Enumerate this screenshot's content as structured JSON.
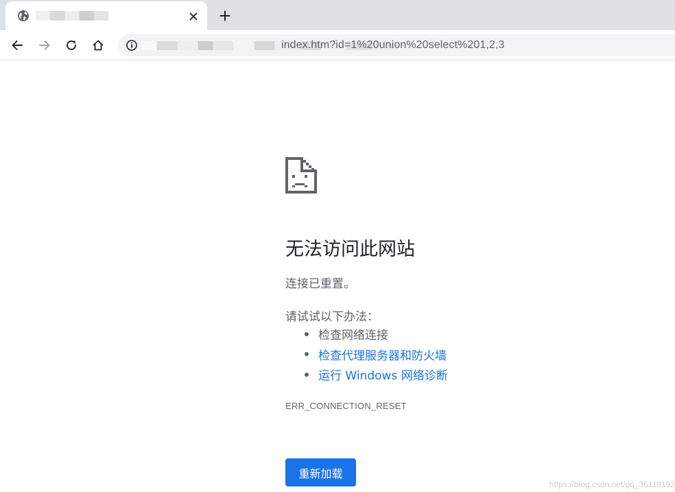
{
  "tab": {
    "favicon": "globe-icon",
    "close_icon": "close-icon"
  },
  "new_tab": {
    "icon": "plus-icon"
  },
  "toolbar": {
    "back_icon": "arrow-left-icon",
    "forward_icon": "arrow-right-icon",
    "reload_icon": "reload-icon",
    "home_icon": "home-icon",
    "info_icon": "info-icon",
    "url_visible": "index.htm?id=1%20union%20select%201,2,3"
  },
  "error_page": {
    "icon": "sad-document-icon",
    "title": "无法访问此网站",
    "subtitle": "连接已重置。",
    "try_label": "请试试以下办法：",
    "suggestions": [
      {
        "text": "检查网络连接",
        "is_link": false
      },
      {
        "text": "检查代理服务器和防火墙",
        "is_link": true
      },
      {
        "text": "运行 Windows 网络诊断",
        "is_link": true
      }
    ],
    "error_code": "ERR_CONNECTION_RESET",
    "reload_label": "重新加载"
  },
  "watermark": "https://blog.csdn.net/qq_36119192",
  "colors": {
    "accent": "#1a73e8",
    "text_primary": "#202124",
    "text_secondary": "#5f6368",
    "tabstrip_bg": "#dee1e6"
  }
}
